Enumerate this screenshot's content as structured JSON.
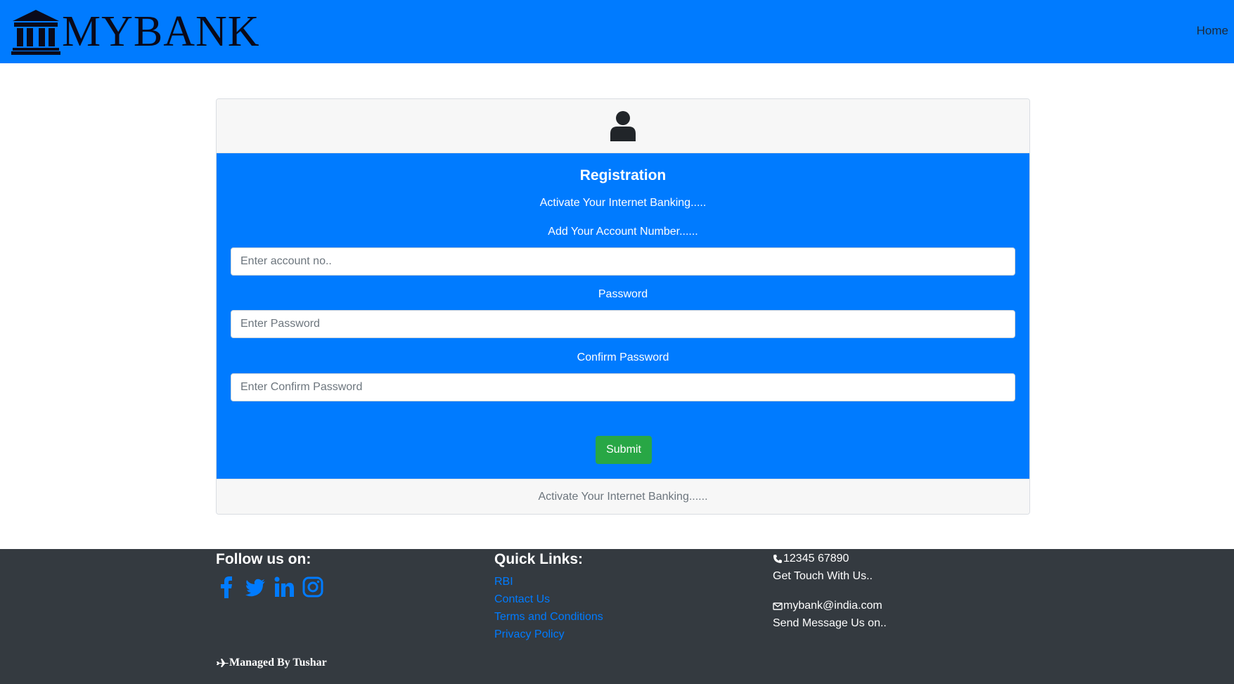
{
  "navbar": {
    "brand": "MYBANK",
    "brand_icon": "bank-icon",
    "home_link": "Home",
    "bg_color": "#007bff"
  },
  "card": {
    "header_icon": "user-icon",
    "title": "Registration",
    "activate_text": "Activate Your Internet Banking.....",
    "account_label": "Add Your Account Number......",
    "account_placeholder": "Enter account no..",
    "password_label": "Password",
    "password_placeholder": "Enter Password",
    "confirm_label": "Confirm Password",
    "confirm_placeholder": "Enter Confirm Password",
    "submit_label": "Submit",
    "footer_text": "Activate Your Internet Banking......",
    "submit_color": "#28a745"
  },
  "footer": {
    "follow_title": "Follow us on:",
    "social_icons": [
      "facebook-icon",
      "twitter-icon",
      "linkedin-icon",
      "instagram-icon"
    ],
    "links_title": "Quick Links:",
    "links": [
      "RBI",
      "Contact Us",
      "Terms and Conditions",
      "Privacy Policy"
    ],
    "phone": "12345 67890",
    "phone_caption": "Get Touch With Us..",
    "email": "mybank@india.com",
    "email_caption": "Send Message Us on..",
    "managed_by": "Managed By Tushar",
    "bg_color": "#343a40"
  }
}
